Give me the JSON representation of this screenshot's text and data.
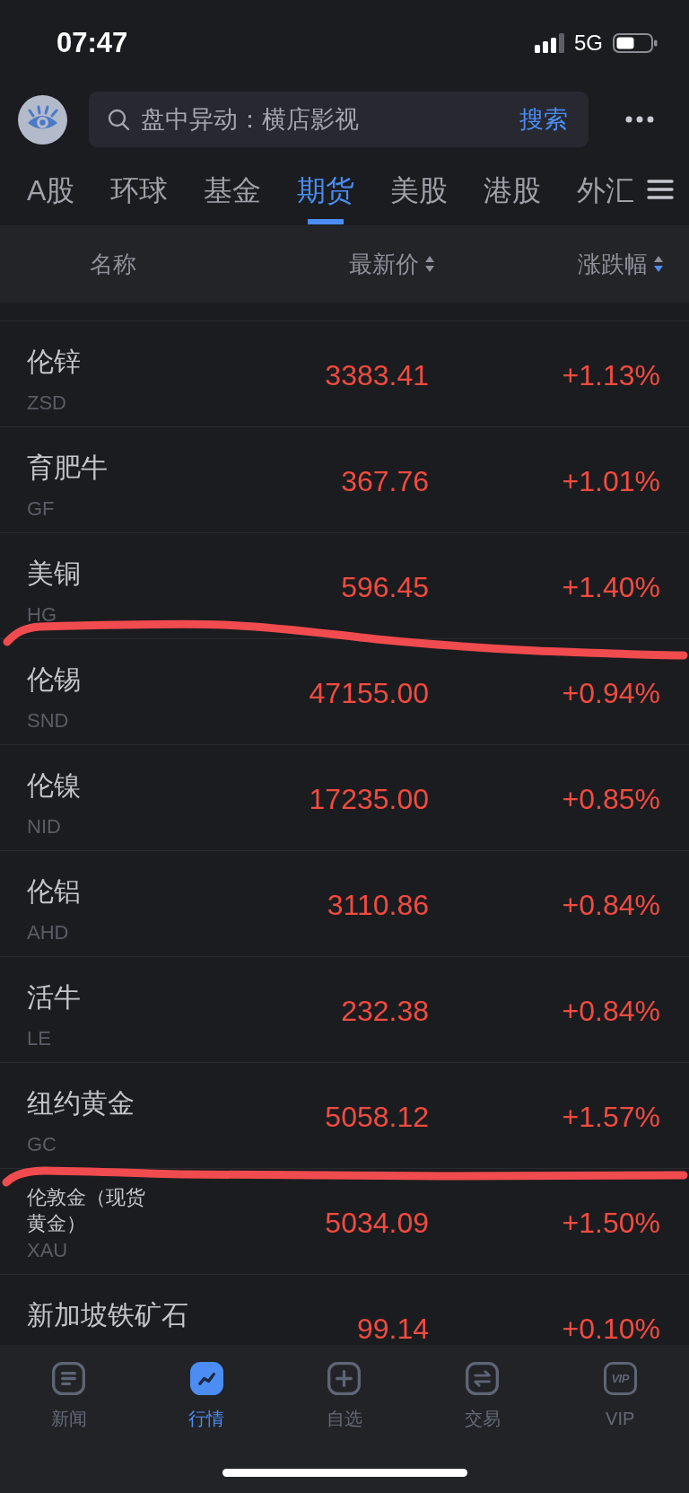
{
  "status_bar": {
    "time": "07:47",
    "network": "5G"
  },
  "search": {
    "placeholder": "盘中异动：横店影视",
    "button": "搜索"
  },
  "tabs": [
    {
      "label": "A股",
      "selected": false
    },
    {
      "label": "环球",
      "selected": false
    },
    {
      "label": "基金",
      "selected": false
    },
    {
      "label": "期货",
      "selected": true
    },
    {
      "label": "美股",
      "selected": false
    },
    {
      "label": "港股",
      "selected": false
    },
    {
      "label": "外汇",
      "selected": false
    }
  ],
  "columns": [
    {
      "label": "名称"
    },
    {
      "label": "最新价",
      "sort_desc": false
    },
    {
      "label": "涨跌幅",
      "sort_desc": true
    }
  ],
  "rows": [
    {
      "kind": "standard",
      "name": "伦锌",
      "code": "ZSD",
      "price": "3383.41",
      "change": "+1.13%",
      "rising": true,
      "pen_mark": false
    },
    {
      "kind": "standard",
      "name": "育肥牛",
      "code": "GF",
      "price": "367.76",
      "change": "+1.01%",
      "rising": true,
      "pen_mark": false
    },
    {
      "kind": "standard",
      "name": "美铜",
      "code": "HG",
      "price": "596.45",
      "change": "+1.40%",
      "rising": true,
      "pen_mark": true
    },
    {
      "kind": "standard",
      "name": "伦锡",
      "code": "SND",
      "price": "47155.00",
      "change": "+0.94%",
      "rising": true,
      "pen_mark": false
    },
    {
      "kind": "standard",
      "name": "伦镍",
      "code": "NID",
      "price": "17235.00",
      "change": "+0.85%",
      "rising": true,
      "pen_mark": false
    },
    {
      "kind": "standard",
      "name": "伦铝",
      "code": "AHD",
      "price": "3110.86",
      "change": "+0.84%",
      "rising": true,
      "pen_mark": false
    },
    {
      "kind": "standard",
      "name": "活牛",
      "code": "LE",
      "price": "232.38",
      "change": "+0.84%",
      "rising": true,
      "pen_mark": false
    },
    {
      "kind": "standard",
      "name": "纽约黄金",
      "code": "GC",
      "price": "5058.12",
      "change": "+1.57%",
      "rising": true,
      "pen_mark": true
    },
    {
      "kind": "compact",
      "name": "伦敦金（现货黄金）",
      "code": "XAU",
      "price": "5034.09",
      "change": "+1.50%",
      "rising": true,
      "pen_mark": false
    },
    {
      "kind": "standard",
      "name": "新加坡铁矿石",
      "price": "99.14",
      "change": "+0.10%",
      "rising": true,
      "pen_mark": false
    }
  ],
  "nav": [
    {
      "kind": "news",
      "label": "新闻",
      "selected": false
    },
    {
      "kind": "market",
      "label": "行情",
      "selected": true
    },
    {
      "kind": "watchlist",
      "label": "自选",
      "selected": false
    },
    {
      "kind": "trade",
      "label": "交易",
      "selected": false
    },
    {
      "kind": "badge",
      "label": "VIP",
      "badge": "VIP",
      "selected": false
    }
  ]
}
